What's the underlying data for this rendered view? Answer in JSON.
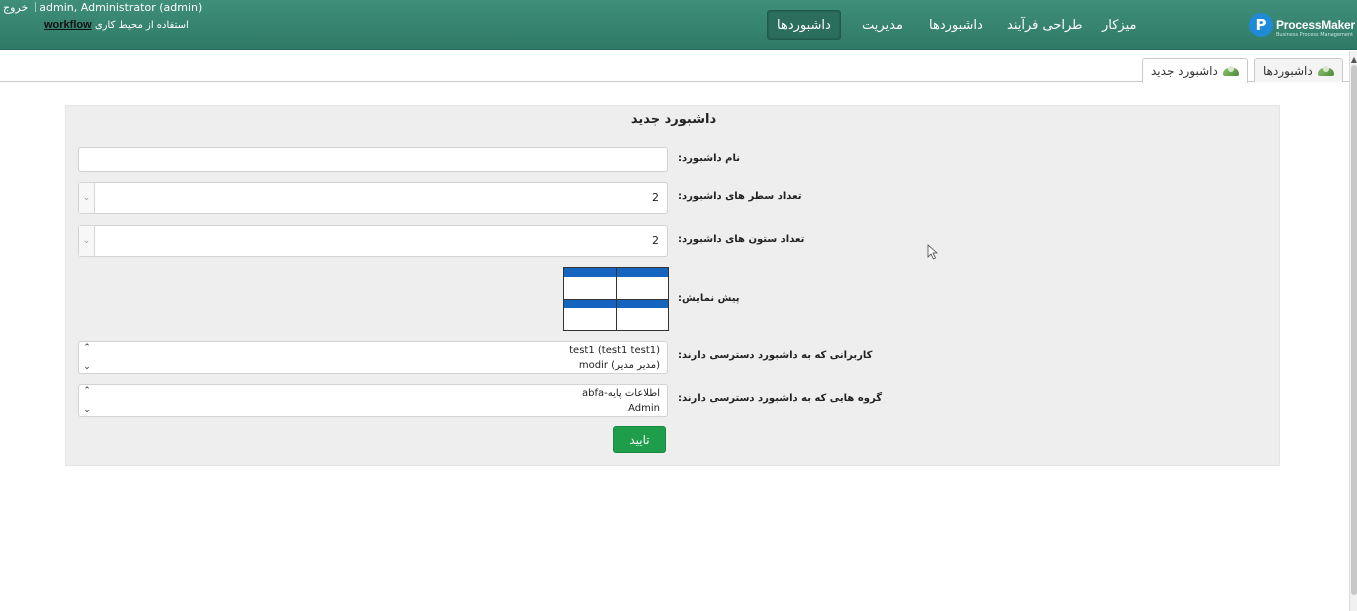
{
  "header": {
    "logo_text": "ProcessMaker",
    "logo_subtext": "Business Process Management",
    "logout_label": "خروج",
    "user_label": "admin, Administrator (admin)",
    "workspace_prefix": "استفاده از محیط کاری",
    "workspace_name": "workflow",
    "nav": [
      {
        "label": "میزکار"
      },
      {
        "label": "طراحی فرآیند"
      },
      {
        "label": "داشبوردها"
      },
      {
        "label": "مدیریت"
      },
      {
        "label": "داشبوردها",
        "active": true
      }
    ],
    "colors": {
      "bar": "#3f8f7a",
      "logo": "#1f8ad6"
    }
  },
  "tabs": [
    {
      "label": "داشبوردها"
    },
    {
      "label": "داشبورد جدید",
      "active": true
    }
  ],
  "form": {
    "title": "داشبورد جدید",
    "name": {
      "label": "نام داشبورد:",
      "value": ""
    },
    "rows": {
      "label": "تعداد سطر های داشبورد:",
      "value": "2"
    },
    "cols": {
      "label": "تعداد ستون های داشبورد:",
      "value": "2"
    },
    "preview": {
      "label": "پیش نمایش:",
      "rows": 2,
      "cols": 2,
      "header_color": "#1565c0"
    },
    "users": {
      "label": "کاربرانی که به داشبورد دسترسی دارند:",
      "items": [
        "test1 (test1 test1)",
        "modir (مدیر مدیر)"
      ]
    },
    "groups": {
      "label": "گروه هایی که به داشبورد دسترسی دارند:",
      "items": [
        "abfa-اطلاعات پایه",
        "Admin"
      ]
    },
    "submit_label": "تایید",
    "submit_color": "#1e9e4a"
  }
}
